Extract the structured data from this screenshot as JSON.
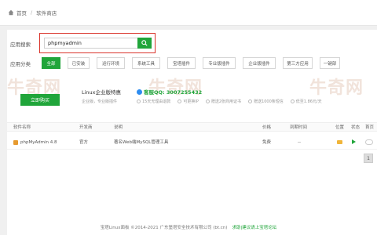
{
  "breadcrumb": {
    "home": "首页",
    "current": "软件商店"
  },
  "search": {
    "label": "应用搜索",
    "value": "phpmyadmin"
  },
  "categories": {
    "label": "应用分类",
    "items": [
      "全部",
      "已安装",
      "运行环境",
      "系统工具",
      "宝塔插件",
      "专业版插件",
      "企业版插件",
      "第三方应用",
      "一键部"
    ]
  },
  "promo": {
    "buy_label": "立即购买",
    "title": "Linux企业版特惠",
    "subtitle": "企业版，专业版插件",
    "qq_label": "客服QQ: 3007255432",
    "features": [
      "15天无理由退款",
      "可更换IP",
      "赠送2张商用证书",
      "赠送1000条短信",
      "低至1.86元/天"
    ],
    "watermark": "牛奇网"
  },
  "table": {
    "headers": [
      "软件名称",
      "开发商",
      "说明",
      "价格",
      "到期时间",
      "位置",
      "状态",
      "首页"
    ],
    "rows": [
      {
        "name": "phpMyAdmin 4.8",
        "developer": "官方",
        "desc": "著名Web端MySQL管理工具",
        "price": "免费",
        "expire": "--"
      }
    ]
  },
  "pager": {
    "page": "1"
  },
  "footer": {
    "copyright": "宝塔Linux面板 ©2014-2021 广东堡塔安全技术有限公司 (bt.cn)",
    "link": "求助|建议请上宝塔论坛"
  }
}
